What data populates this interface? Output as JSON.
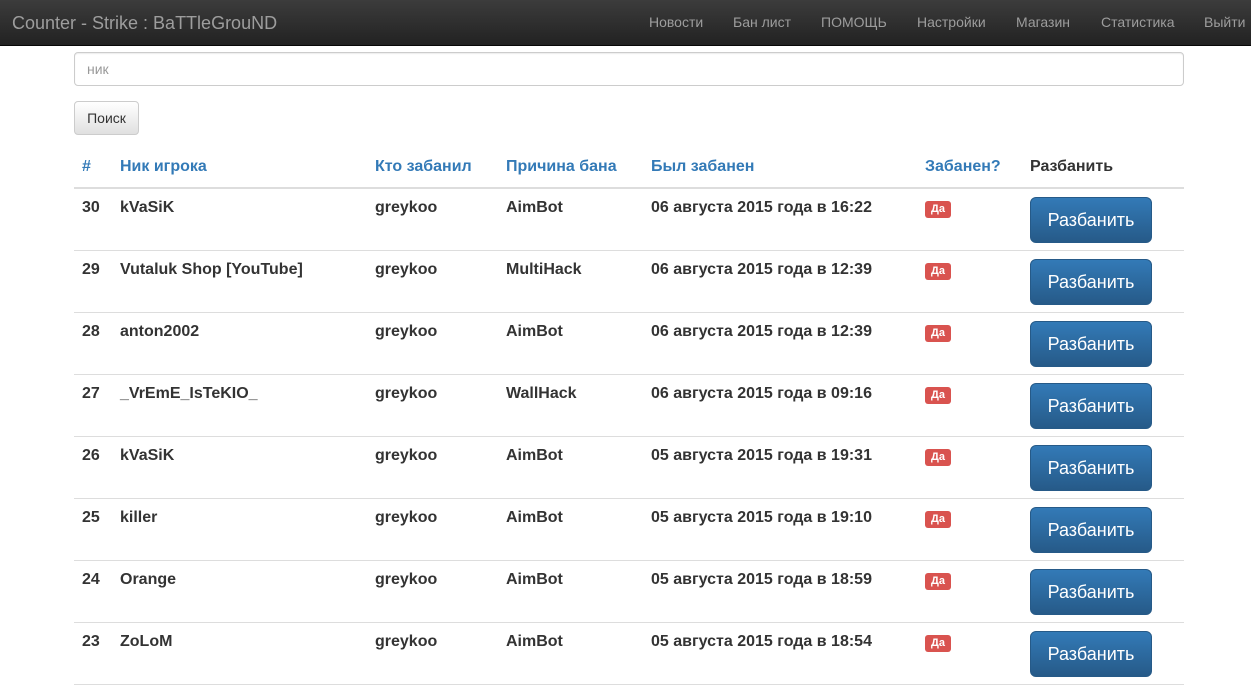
{
  "navbar": {
    "brand": "Counter - Strike : BaTTleGrouND",
    "items": [
      "Новости",
      "Бан лист",
      "ПОМОЩЬ",
      "Настройки",
      "Магазин",
      "Статистика",
      "Выйти"
    ]
  },
  "search": {
    "placeholder": "ник",
    "button_label": "Поиск"
  },
  "table": {
    "headers": {
      "id": "#",
      "nick": "Ник игрока",
      "banned_by": "Кто забанил",
      "reason": "Причина бана",
      "banned_at": "Был забанен",
      "is_banned": "Забанен?",
      "unban": "Разбанить"
    },
    "rows": [
      {
        "id": "30",
        "nick": "kVaSiK",
        "banned_by": "greykoo",
        "reason": "AimBot",
        "banned_at": "06 августа 2015 года в 16:22",
        "badge": "Да",
        "action": "Разбанить"
      },
      {
        "id": "29",
        "nick": "Vutaluk Shop [YouTube]",
        "banned_by": "greykoo",
        "reason": "MultiHack",
        "banned_at": "06 августа 2015 года в 12:39",
        "badge": "Да",
        "action": "Разбанить"
      },
      {
        "id": "28",
        "nick": "anton2002",
        "banned_by": "greykoo",
        "reason": "AimBot",
        "banned_at": "06 августа 2015 года в 12:39",
        "badge": "Да",
        "action": "Разбанить"
      },
      {
        "id": "27",
        "nick": "_VrEmE_IsTeKIO_",
        "banned_by": "greykoo",
        "reason": "WallHack",
        "banned_at": "06 августа 2015 года в 09:16",
        "badge": "Да",
        "action": "Разбанить"
      },
      {
        "id": "26",
        "nick": "kVaSiK",
        "banned_by": "greykoo",
        "reason": "AimBot",
        "banned_at": "05 августа 2015 года в 19:31",
        "badge": "Да",
        "action": "Разбанить"
      },
      {
        "id": "25",
        "nick": "killer",
        "banned_by": "greykoo",
        "reason": "AimBot",
        "banned_at": "05 августа 2015 года в 19:10",
        "badge": "Да",
        "action": "Разбанить"
      },
      {
        "id": "24",
        "nick": "Orange",
        "banned_by": "greykoo",
        "reason": "AimBot",
        "banned_at": "05 августа 2015 года в 18:59",
        "badge": "Да",
        "action": "Разбанить"
      },
      {
        "id": "23",
        "nick": "ZoLoM",
        "banned_by": "greykoo",
        "reason": "AimBot",
        "banned_at": "05 августа 2015 года в 18:54",
        "badge": "Да",
        "action": "Разбанить"
      }
    ]
  },
  "colors": {
    "link": "#337ab7",
    "badge_danger": "#d9534f",
    "primary_button": "#337ab7",
    "navbar": "#222222"
  }
}
